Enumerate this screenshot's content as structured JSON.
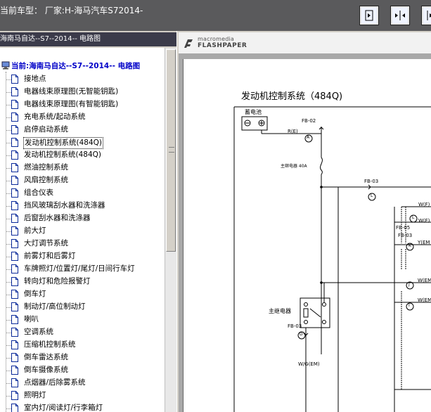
{
  "header": {
    "car_info": "当前车型：  厂家:H-海马汽车S72014-"
  },
  "toolbar": {
    "buttons": [
      "fit-page-icon",
      "fit-width-icon",
      "next-page-icon"
    ]
  },
  "left_panel": {
    "title": "海南马自达--S7--2014-- 电路图",
    "root_label": "当前:海南马自达--S7--2014-- 电路图",
    "items": [
      "接地点",
      "电器线束原理图(无智能钥匙)",
      "电器线束原理图(有智能钥匙)",
      "充电系统/起动系统",
      "启停启动系统",
      "发动机控制系统(484Q)",
      "发动机控制系统(484Q)",
      "燃油控制系统",
      "风扇控制系统",
      "组合仪表",
      "挡风玻璃刮水器和洗涤器",
      "后窗刮水器和洗涤器",
      "前大灯",
      "大灯调节系统",
      "前雾灯和后雾灯",
      "车牌照灯/位置灯/尾灯/日间行车灯",
      "转向灯和危险报警灯",
      "倒车灯",
      "制动灯/高位制动灯",
      "喇叭",
      "空调系统",
      "压缩机控制系统",
      "倒车雷达系统",
      "倒车摄像系统",
      "点烟器/后除雾系统",
      "照明灯",
      "室内灯/阅读灯/行李箱灯"
    ],
    "selected_index": 5
  },
  "viewer": {
    "logo_top": "macromedia",
    "logo_bottom": "FLASHPAPER",
    "diagram": {
      "title": "发动机控制系统（484Q)",
      "battery_label": "蓄电池",
      "wire_re": "R(E)",
      "fb02": "FB-02",
      "fuse_label": "主继电器 40A",
      "fb03_top": "FB-03",
      "main_relay": "主继电器",
      "fb03_mid": "FB-03",
      "wire_wg": "W/G(EM)",
      "connector_a": "A",
      "connector_l": "L",
      "connector_d": "D",
      "connector_l2": "L",
      "connector_k": "K",
      "connector_j": "J",
      "connector_i": "I",
      "right_fb05": "FB-05",
      "right_fb03": "FB-03",
      "right_w1": "W(F)",
      "right_w2": "W(F)",
      "right_y": "Y(EM",
      "right_w3": "W(EM",
      "right_w4": "W(EM"
    }
  },
  "colors": {
    "topbar": "#5a5a5c",
    "tree_text": "#000000",
    "root_text": "#0000c8"
  }
}
